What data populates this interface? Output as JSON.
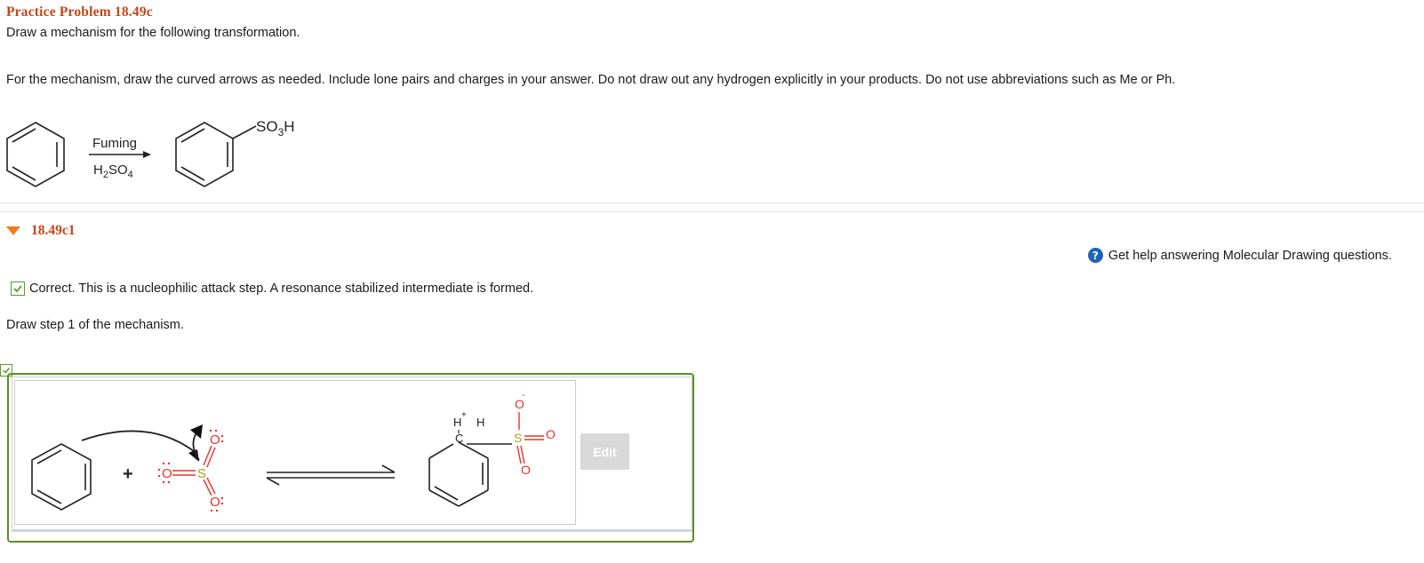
{
  "problem": {
    "title": "Practice Problem 18.49c",
    "prompt": "Draw a mechanism for the following transformation.",
    "instructions": "For the mechanism, draw the curved arrows as needed. Include lone pairs and charges in your answer. Do not draw out any hydrogen explicitly in your products. Do not use abbreviations such as Me or Ph."
  },
  "reaction": {
    "reagent_top": "Fuming",
    "reagent_bottom_main": "H",
    "reagent_bottom_sub": "2",
    "reagent_bottom_rest": "SO",
    "reagent_bottom_sub2": "4",
    "product_label": "SO",
    "product_label_sub": "3",
    "product_label_rest": "H"
  },
  "section": {
    "label": "18.49c1"
  },
  "help": {
    "icon_glyph": "?",
    "text": "Get help answering Molecular Drawing questions."
  },
  "feedback": {
    "text": "Correct. This is a nucleophilic attack step. A resonance stabilized intermediate is formed."
  },
  "step": {
    "text": "Draw step 1 of the mechanism."
  },
  "mechanism": {
    "plus": "+",
    "atom_o": "O",
    "atom_s": "S",
    "atom_c": "C",
    "atom_h": "H",
    "plus_charge": "+",
    "minus_charge": "-"
  },
  "edit_button": {
    "label": "Edit"
  },
  "colors": {
    "title": "#c4461a",
    "check_green": "#5b8f23",
    "help_blue": "#1f63b6",
    "oxygen_red": "#e8332a",
    "sulfur_olive": "#a5a51a"
  }
}
